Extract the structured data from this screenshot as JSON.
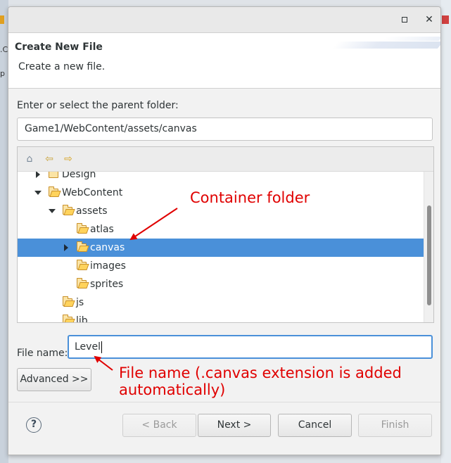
{
  "background": {
    "left_fragment_1": ".C",
    "left_fragment_2": "p"
  },
  "dialog": {
    "header": {
      "title": "Create New File",
      "description": "Create a new file."
    },
    "parent_folder_label": "Enter or select the parent folder:",
    "parent_folder_value": "Game1/WebContent/assets/canvas",
    "tree_toolbar": {
      "icons": [
        "home-icon",
        "back-arrow-icon",
        "forward-arrow-icon"
      ]
    },
    "tree_items": [
      {
        "label": "Design",
        "expander": "collapsed"
      },
      {
        "label": "WebContent",
        "expander": "expanded"
      },
      {
        "label": "assets",
        "expander": "expanded"
      },
      {
        "label": "atlas",
        "expander": "none"
      },
      {
        "label": "canvas",
        "expander": "collapsed",
        "selected": true
      },
      {
        "label": "images",
        "expander": "none"
      },
      {
        "label": "sprites",
        "expander": "none"
      },
      {
        "label": "js",
        "expander": "none"
      },
      {
        "label": "lib",
        "expander": "none"
      }
    ],
    "file_name_label": "File name:",
    "file_name_value": "Level",
    "advanced_label": "Advanced >>",
    "buttons": {
      "help": "?",
      "back": "< Back",
      "next": "Next >",
      "cancel": "Cancel",
      "finish": "Finish"
    }
  },
  "annotations": {
    "container_folder": "Container folder",
    "file_name_line1": "File name (.canvas extension is added",
    "file_name_line2": "automatically)"
  },
  "colors": {
    "selection": "#4a90d9",
    "annotation": "#e00000"
  }
}
